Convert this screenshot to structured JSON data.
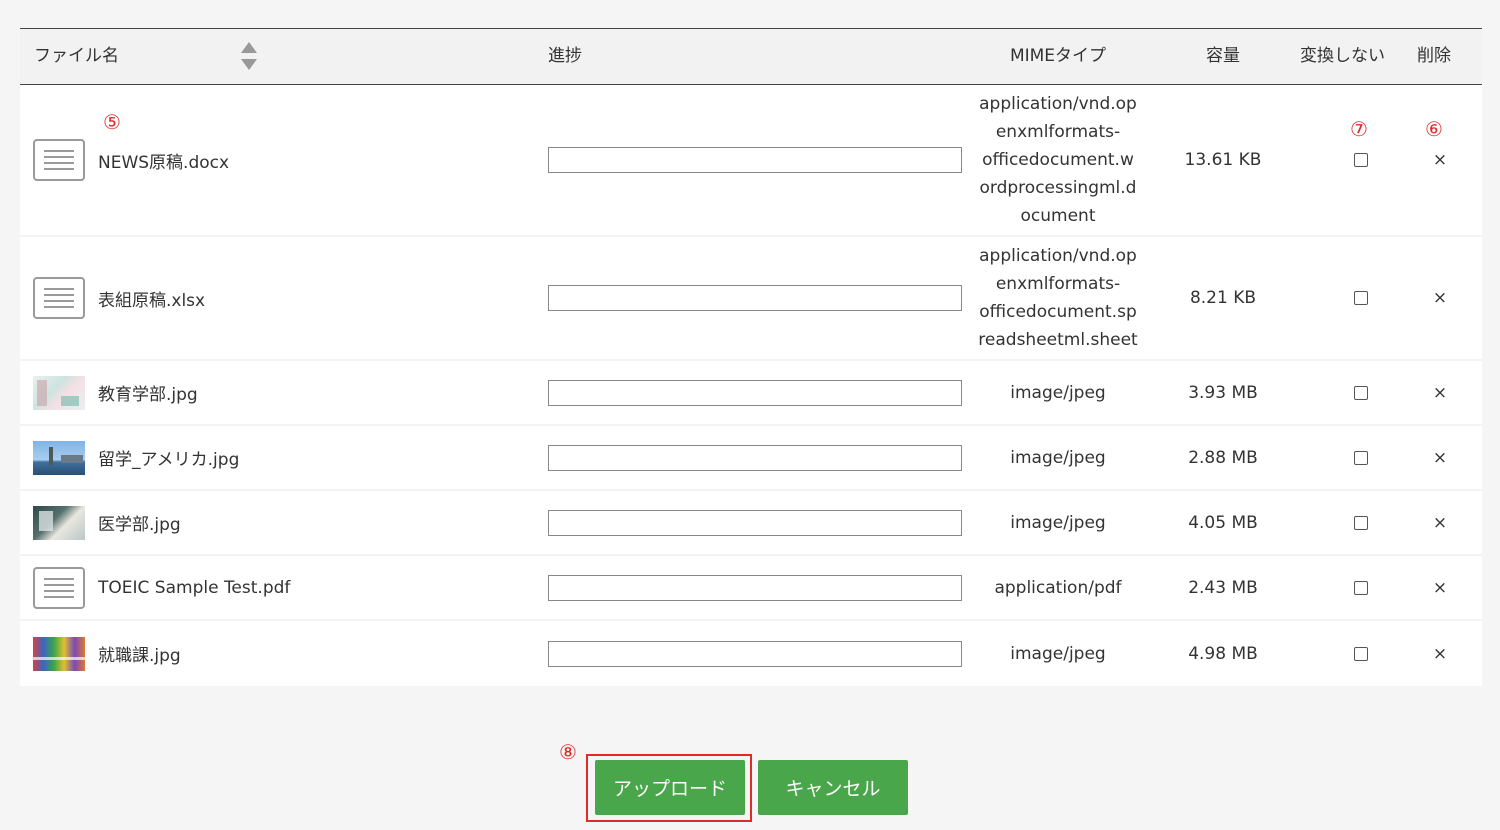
{
  "table": {
    "headers": {
      "name": "ファイル名",
      "progress": "進捗",
      "mime": "MIMEタイプ",
      "size": "容量",
      "no_convert": "変換しない",
      "delete": "削除"
    },
    "rows": [
      {
        "icon": "document-icon",
        "name": "NEWS原稿.docx",
        "mime": "application/vnd.op enxmlformats- officedocument.w ordprocessingml.d ocument",
        "size": "13.61 KB",
        "no_convert": false,
        "delete_label": "×"
      },
      {
        "icon": "document-icon",
        "name": "表組原稿.xlsx",
        "mime": "application/vnd.op enxmlformats- officedocument.sp readsheetml.sheet",
        "size": "8.21 KB",
        "no_convert": false,
        "delete_label": "×"
      },
      {
        "icon": "image-thumbnail",
        "name": "教育学部.jpg",
        "mime": "image/jpeg",
        "size": "3.93 MB",
        "no_convert": false,
        "delete_label": "×"
      },
      {
        "icon": "image-thumbnail",
        "name": "留学_アメリカ.jpg",
        "mime": "image/jpeg",
        "size": "2.88 MB",
        "no_convert": false,
        "delete_label": "×"
      },
      {
        "icon": "image-thumbnail",
        "name": "医学部.jpg",
        "mime": "image/jpeg",
        "size": "4.05 MB",
        "no_convert": false,
        "delete_label": "×"
      },
      {
        "icon": "document-icon",
        "name": "TOEIC Sample Test.pdf",
        "mime": "application/pdf",
        "size": "2.43 MB",
        "no_convert": false,
        "delete_label": "×"
      },
      {
        "icon": "image-thumbnail",
        "name": "就職課.jpg",
        "mime": "image/jpeg",
        "size": "4.98 MB",
        "no_convert": false,
        "delete_label": "×"
      }
    ]
  },
  "annotations": {
    "file_name": "⑤",
    "delete": "⑥",
    "no_convert": "⑦",
    "upload": "⑧"
  },
  "actions": {
    "upload_label": "アップロード",
    "cancel_label": "キャンセル"
  },
  "colors": {
    "button_green": "#4aa64a",
    "annotation_red": "#e02b2b",
    "header_bg": "#f2f2f2"
  }
}
